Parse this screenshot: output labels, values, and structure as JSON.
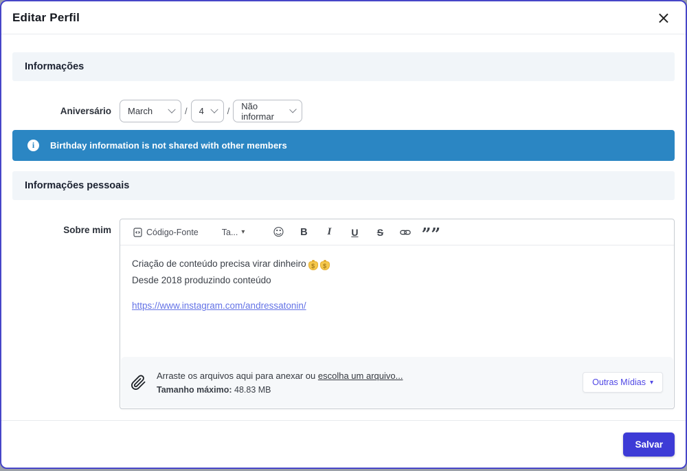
{
  "modal": {
    "title": "Editar Perfil"
  },
  "icons": {
    "close": "×",
    "caret_down": "▾",
    "info": "i",
    "smiley": "☺",
    "quote": "”"
  },
  "sections": {
    "info_header": "Informações",
    "personal_header": "Informações pessoais"
  },
  "birthday": {
    "label": "Aniversário",
    "month_value": "March",
    "day_value": "4",
    "year_value": "Não informar",
    "separator": "/"
  },
  "banner": {
    "text": "Birthday information is not shared with other members"
  },
  "about": {
    "label": "Sobre mim",
    "toolbar": {
      "source_label": "Código-Fonte",
      "size_label": "Ta...",
      "bold": "B",
      "italic": "I",
      "underline": "U",
      "strike": "S"
    },
    "content": {
      "line1": "Criação de conteúdo precisa virar dinheiro",
      "line1_emojis": [
        "money-bag",
        "money-bag"
      ],
      "line2": "Desde 2018 produzindo conteúdo",
      "link": "https://www.instagram.com/andressatonin/"
    },
    "attach": {
      "drag_text": "Arraste os arquivos aqui para anexar ou",
      "choose_link": "escolha um arquivo...",
      "max_label": "Tamanho máximo:",
      "max_value": "48.83 MB",
      "other_media_label": "Outras Mídias"
    }
  },
  "footer": {
    "save_label": "Salvar"
  },
  "colors": {
    "accent": "#3d3bd6",
    "modal_border": "#4645c8",
    "banner_blue": "#2b86c3",
    "section_band": "#f1f5f9",
    "content_link": "#6473e6",
    "other_media_text": "#4f46e5"
  }
}
